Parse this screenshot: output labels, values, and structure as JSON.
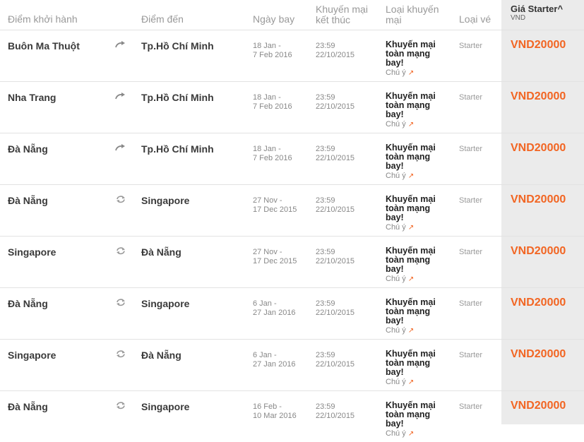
{
  "header": {
    "from": "Điểm khởi hành",
    "to": "Điểm đến",
    "date": "Ngày bay",
    "promo_end_1": "Khuyến mại",
    "promo_end_2": "kết thúc",
    "promo_type_1": "Loại khuyến",
    "promo_type_2": "mại",
    "ticket_type": "Loại vé",
    "price_label": "Giá Starter^",
    "price_currency": "VND"
  },
  "rows": [
    {
      "from": "Buôn Ma Thuột",
      "icon": "oneway-arrow-icon",
      "to": "Tp.Hồ Chí Minh",
      "date_1": "18 Jan -",
      "date_2": "7 Feb 2016",
      "end_1": "23:59",
      "end_2": "22/10/2015",
      "promo_1": "Khuyến mại",
      "promo_2": "toàn mạng",
      "promo_3": "bay!",
      "note": "Chú ý",
      "ticket": "Starter",
      "price": "VND20000"
    },
    {
      "from": "Nha Trang",
      "icon": "oneway-arrow-icon",
      "to": "Tp.Hồ Chí Minh",
      "date_1": "18 Jan -",
      "date_2": "7 Feb 2016",
      "end_1": "23:59",
      "end_2": "22/10/2015",
      "promo_1": "Khuyến mại",
      "promo_2": "toàn mạng",
      "promo_3": "bay!",
      "note": "Chú ý",
      "ticket": "Starter",
      "price": "VND20000"
    },
    {
      "from": "Đà Nẵng",
      "icon": "oneway-arrow-icon",
      "to": "Tp.Hồ Chí Minh",
      "date_1": "18 Jan -",
      "date_2": "7 Feb 2016",
      "end_1": "23:59",
      "end_2": "22/10/2015",
      "promo_1": "Khuyến mại",
      "promo_2": "toàn mạng",
      "promo_3": "bay!",
      "note": "Chú ý",
      "ticket": "Starter",
      "price": "VND20000"
    },
    {
      "from": "Đà Nẵng",
      "icon": "roundtrip-icon",
      "to": "Singapore",
      "date_1": "27 Nov -",
      "date_2": "17 Dec 2015",
      "end_1": "23:59",
      "end_2": "22/10/2015",
      "promo_1": "Khuyến mại",
      "promo_2": "toàn mạng",
      "promo_3": "bay!",
      "note": "Chú ý",
      "ticket": "Starter",
      "price": "VND20000"
    },
    {
      "from": "Singapore",
      "icon": "roundtrip-icon",
      "to": "Đà Nẵng",
      "date_1": "27 Nov -",
      "date_2": "17 Dec 2015",
      "end_1": "23:59",
      "end_2": "22/10/2015",
      "promo_1": "Khuyến mại",
      "promo_2": "toàn mạng",
      "promo_3": "bay!",
      "note": "Chú ý",
      "ticket": "Starter",
      "price": "VND20000"
    },
    {
      "from": "Đà Nẵng",
      "icon": "roundtrip-icon",
      "to": "Singapore",
      "date_1": "6 Jan -",
      "date_2": "27 Jan 2016",
      "end_1": "23:59",
      "end_2": "22/10/2015",
      "promo_1": "Khuyến mại",
      "promo_2": "toàn mạng",
      "promo_3": "bay!",
      "note": "Chú ý",
      "ticket": "Starter",
      "price": "VND20000"
    },
    {
      "from": "Singapore",
      "icon": "roundtrip-icon",
      "to": "Đà Nẵng",
      "date_1": "6 Jan -",
      "date_2": "27 Jan 2016",
      "end_1": "23:59",
      "end_2": "22/10/2015",
      "promo_1": "Khuyến mại",
      "promo_2": "toàn mạng",
      "promo_3": "bay!",
      "note": "Chú ý",
      "ticket": "Starter",
      "price": "VND20000"
    },
    {
      "from": "Đà Nẵng",
      "icon": "roundtrip-icon",
      "to": "Singapore",
      "date_1": "16 Feb -",
      "date_2": "10 Mar 2016",
      "end_1": "23:59",
      "end_2": "22/10/2015",
      "promo_1": "Khuyến mại",
      "promo_2": "toàn mạng",
      "promo_3": "bay!",
      "note": "Chú ý",
      "ticket": "Starter",
      "price": "VND20000"
    }
  ],
  "colors": {
    "accent": "#f26522",
    "price_column_bg": "#ebebeb"
  }
}
